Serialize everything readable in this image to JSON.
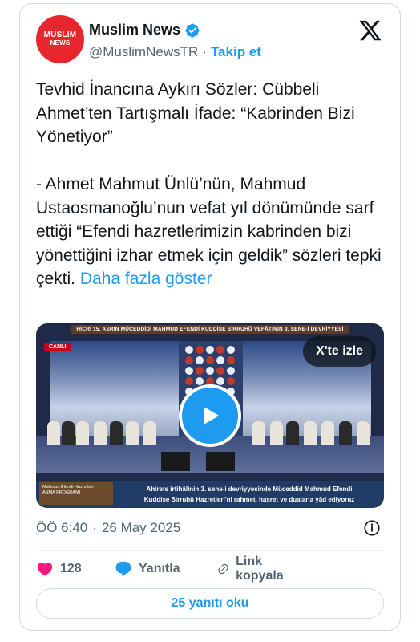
{
  "author": {
    "name": "Muslim News",
    "handle": "@MuslimNewsTR",
    "separator": "·",
    "follow_label": "Takip et",
    "avatar_text_top": "MUSLIM",
    "avatar_text_bottom": "NEWS"
  },
  "tweet": {
    "text": "Tevhid İnancına Aykırı Sözler: Cübbeli Ahmet’ten Tartışmalı İfade: “Kabrinden Bizi Yönetiyor”\n\n- Ahmet Mahmut Ünlü’nün, Mahmud Ustaosmanoğlu’nun vefat yıl dönümünde sarf ettiği “Efendi hazretlerimizin kabrinden bizi yönettiğini izhar etmek için geldik” sözleri tepki çekti. ",
    "show_more_label": "Daha fazla göster"
  },
  "video": {
    "watch_on_x_label": "X'te izle",
    "banner_top": "HİCRİ 15. ASRIN MÜCEDDİDİ MAHMUD EFENDİ KUDDİSE SİRRUHÛ VEFÂTININ 3. SENE-İ DEVRİYYESİ",
    "live_badge": "CANLI",
    "lower_third_left_title": "Mahmud Efendi Hazretleri",
    "lower_third_left_sub": "ANMA PROGRAMI",
    "lower_third_line1": "Âhirete irtihâlinin 3. sene-i devriyyesinde Müceddid Mahmud Efendi",
    "lower_third_line2": "Kuddise Sirruhû Hazretleri'ni rahmet, hasret ve dualarla yâd ediyoruz"
  },
  "meta": {
    "time": "ÖÖ 6:40",
    "separator": "·",
    "date": "26 May 2025"
  },
  "actions": {
    "likes_count": "128",
    "reply_label": "Yanıtla",
    "copy_link_label": "Link kopyala"
  },
  "replies_button_label": "25 yanıtı oku",
  "colors": {
    "accent": "#1d9bf0",
    "like": "#f91880",
    "secondary_text": "#536471",
    "avatar_bg": "#e8262d"
  }
}
